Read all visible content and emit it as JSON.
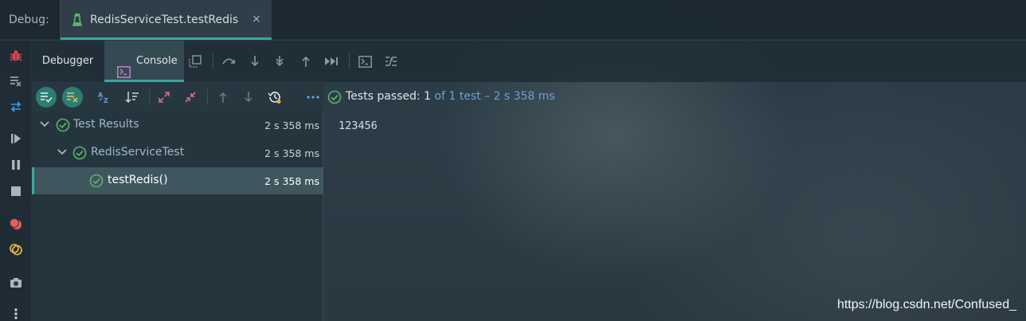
{
  "debug_bar": {
    "label": "Debug:",
    "run_config_tab": "RedisServiceTest.testRedis",
    "close_glyph": "×"
  },
  "toolbar": {
    "debugger_tab": "Debugger",
    "console_tab": "Console"
  },
  "status": {
    "passed_label": "Tests passed:",
    "passed_count": "1",
    "of_total": "of 1 test",
    "duration": "– 2 s 358 ms"
  },
  "tree": {
    "root": {
      "label": "Test Results",
      "time": "2 s 358 ms"
    },
    "suite": {
      "label": "RedisServiceTest",
      "time": "2 s 358 ms"
    },
    "test": {
      "label": "testRedis()",
      "time": "2 s 358 ms"
    }
  },
  "console": {
    "output": "123456"
  },
  "watermark": "https://blog.csdn.net/Confused_",
  "colors": {
    "accent_teal": "#3aa6a0",
    "pass_green": "#5bb36b",
    "link_blue": "#6d9fd8",
    "bug_red": "#e0474c",
    "stop_red": "#e05c5c",
    "breakpoint_red": "#f05a5f",
    "mute_yellow": "#e0b442"
  },
  "icons": {
    "run_tab": "flask-icon",
    "left_toolbar": [
      "bug-icon",
      "clear-list-icon",
      "rerun-swap-icon",
      "resume-icon",
      "pause-icon",
      "stop-icon",
      "view-breakpoints-icon",
      "mute-breakpoints-icon",
      "camera-icon",
      "more-vertical-icon"
    ],
    "debug_toolbar": [
      "restore-layout-icon",
      "step-over-icon",
      "step-into-icon",
      "force-step-into-icon",
      "step-out-icon",
      "run-to-cursor-icon",
      "evaluate-expression-icon",
      "trace-icon"
    ],
    "test_toolbar": [
      "show-passed-icon",
      "show-ignored-icon",
      "sort-alpha-icon",
      "sort-duration-icon",
      "expand-all-icon",
      "collapse-all-icon",
      "prev-failed-icon",
      "next-failed-icon",
      "test-history-icon",
      "more-horizontal-icon"
    ]
  }
}
